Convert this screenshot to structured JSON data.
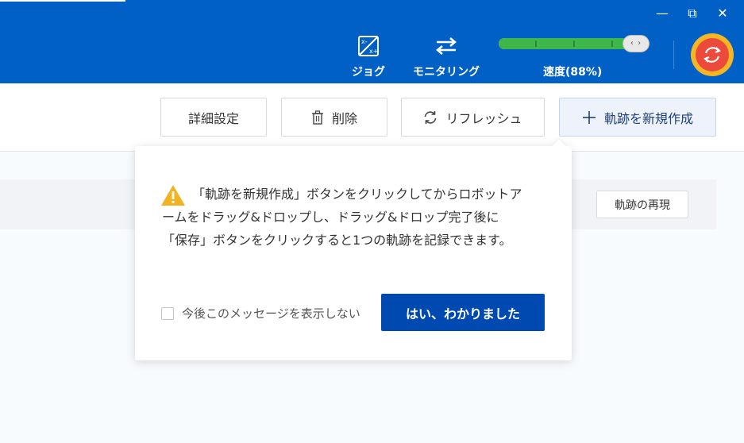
{
  "window": {
    "minimize": "—",
    "restore": "⧉",
    "close": "✕"
  },
  "header": {
    "tools": [
      {
        "label": "ジョグ",
        "icon": "jog-icon"
      },
      {
        "label": "モニタリング",
        "icon": "swap-arrows-icon"
      }
    ],
    "speed": {
      "label": "速度(88%)",
      "value_percent": 88,
      "knob_text": "‹ ›"
    },
    "robot_button_icon": "refresh-circle-icon"
  },
  "toolbar": {
    "detail_label": "詳細設定",
    "delete_label": "削除",
    "refresh_label": "リフレッシュ",
    "new_label": "軌跡を新規作成"
  },
  "list": {
    "replay_label": "軌跡の再現"
  },
  "popover": {
    "message": "「軌跡を新規作成」ボタンをクリックしてからロボットアームをドラッグ&ドロップし、ドラッグ&ドロップ完了後に「保存」ボタンをクリックすると1つの軌跡を記録できます。",
    "checkbox_label": "今後このメッセージを表示しない",
    "confirm_label": "はい、わかりました"
  },
  "colors": {
    "header": "#0060c6",
    "speed_fill": "#3fb649",
    "primary_button": "#0049b0",
    "warning": "#f0b323",
    "robot_outer": "#f4b623",
    "robot_inner": "#ec4a3b"
  }
}
